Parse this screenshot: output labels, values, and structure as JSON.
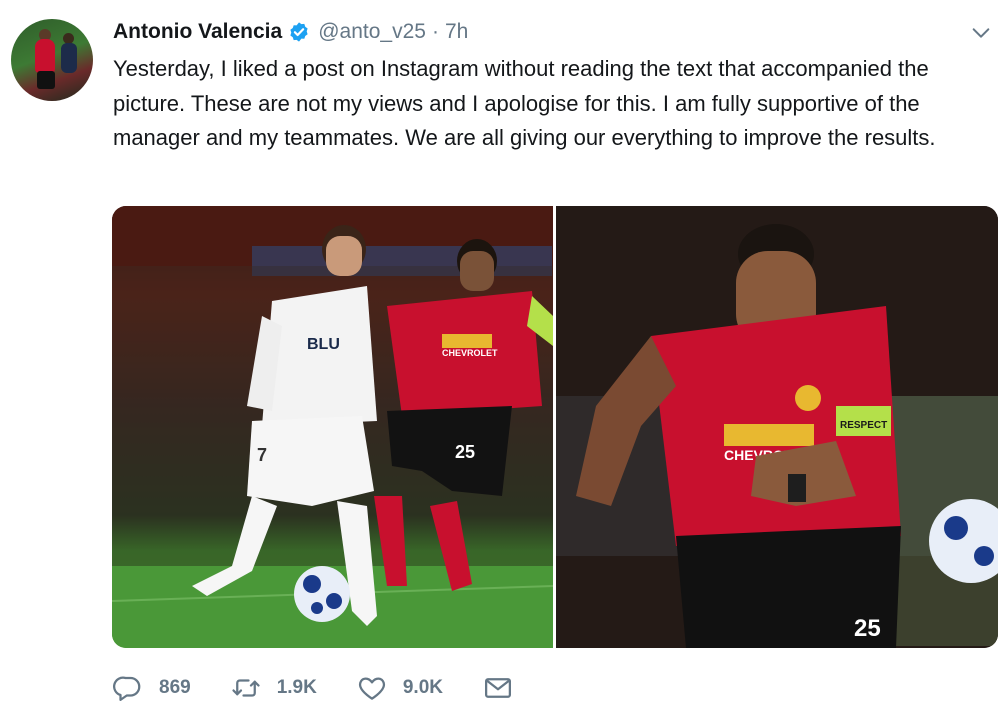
{
  "tweet": {
    "author_name": "Antonio Valencia",
    "handle": "@anto_v25",
    "separator": "·",
    "time": "7h",
    "text": "Yesterday, I liked a post on Instagram without reading the text that accompanied the picture. These are not my views and I apologise for this. I am fully supportive of the manager and my teammates. We are all giving our everything to improve the results."
  },
  "media": {
    "left_photo": {
      "shirt_sponsor_valencia": "BLU",
      "shirt_number_valencia": "7",
      "shirt_number_united": "25",
      "shirt_sponsor_united": "CHEVROLET"
    },
    "right_photo": {
      "shirt_sponsor": "CHEVROLET",
      "armband": "RESPECT",
      "shirt_number": "25"
    }
  },
  "actions": {
    "reply_count": "869",
    "retweet_count": "1.9K",
    "like_count": "9.0K"
  },
  "icons": [
    "verified-icon",
    "chevron-down-icon",
    "reply-icon",
    "retweet-icon",
    "like-icon",
    "direct-message-icon"
  ],
  "colors": {
    "text": "#14171a",
    "muted": "#657786",
    "verified": "#1da1f2",
    "united_red": "#c8102e"
  }
}
